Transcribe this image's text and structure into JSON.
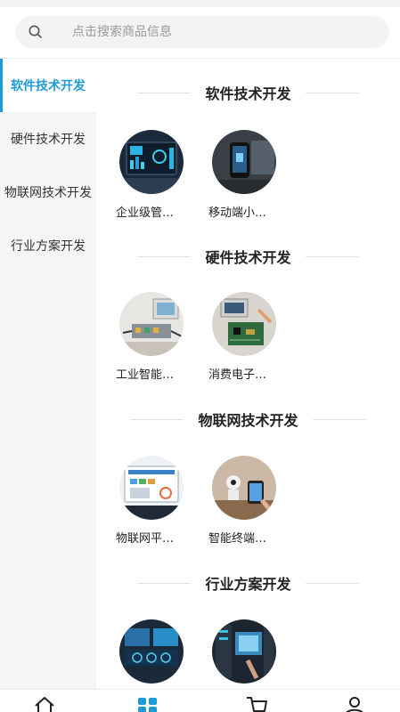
{
  "search": {
    "placeholder": "点击搜索商品信息"
  },
  "sidebar": {
    "items": [
      {
        "label": "软件技术开发",
        "active": true
      },
      {
        "label": "硬件技术开发",
        "active": false
      },
      {
        "label": "物联网技术开发",
        "active": false
      },
      {
        "label": "行业方案开发",
        "active": false
      }
    ]
  },
  "sections": [
    {
      "title": "软件技术开发",
      "products": [
        {
          "label": "企业级管…",
          "image": "dashboard-monitor-image"
        },
        {
          "label": "移动端小…",
          "image": "mobile-app-image"
        }
      ]
    },
    {
      "title": "硬件技术开发",
      "products": [
        {
          "label": "工业智能…",
          "image": "industrial-hardware-image"
        },
        {
          "label": "消费电子…",
          "image": "circuit-board-image"
        }
      ]
    },
    {
      "title": "物联网技术开发",
      "products": [
        {
          "label": "物联网平…",
          "image": "iot-platform-image"
        },
        {
          "label": "智能终端…",
          "image": "smart-device-image"
        }
      ]
    },
    {
      "title": "行业方案开发",
      "products": [
        {
          "label": "",
          "image": "data-center-image"
        },
        {
          "label": "",
          "image": "server-room-image"
        }
      ]
    }
  ],
  "tabbar": {
    "items": [
      "home-icon",
      "category-icon",
      "cart-icon",
      "user-icon"
    ],
    "active_index": 1
  },
  "colors": {
    "accent": "#1e9bd7",
    "sidebar_bg": "#f5f5f5",
    "search_bg": "#f3f3f3"
  }
}
